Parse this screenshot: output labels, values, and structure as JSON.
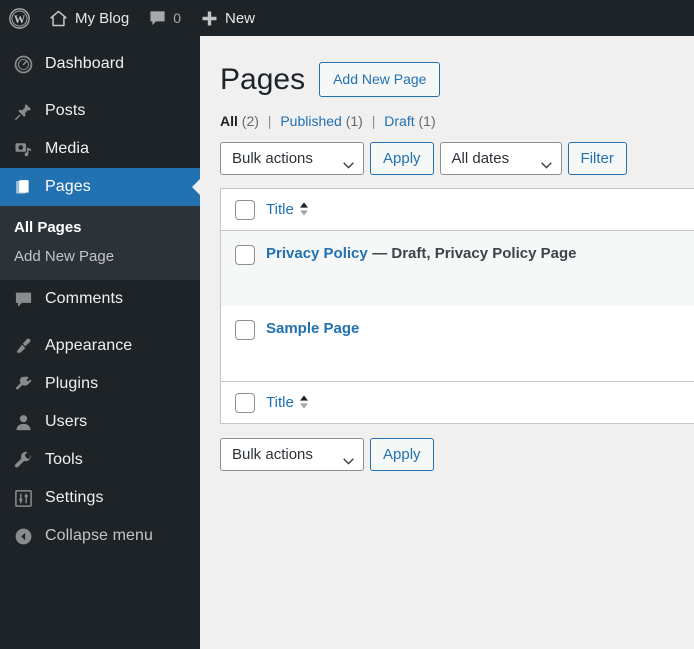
{
  "adminbar": {
    "wp_logo_icon": "wordpress-logo-icon",
    "site_home_icon": "home-icon",
    "site_name": "My Blog",
    "comments_icon": "comment-bubble-icon",
    "comments_count": "0",
    "new_icon": "plus-icon",
    "new_label": "New"
  },
  "sidebar": {
    "items": [
      {
        "label": "Dashboard",
        "icon": "dashboard-gauge-icon",
        "key": "dashboard"
      },
      {
        "label": "Posts",
        "icon": "pushpin-icon",
        "key": "posts"
      },
      {
        "label": "Media",
        "icon": "media-camera-music-icon",
        "key": "media"
      },
      {
        "label": "Pages",
        "icon": "pages-icon",
        "key": "pages"
      },
      {
        "label": "Comments",
        "icon": "comment-bubble-icon",
        "key": "comments"
      },
      {
        "label": "Appearance",
        "icon": "paintbrush-icon",
        "key": "appearance"
      },
      {
        "label": "Plugins",
        "icon": "plug-icon",
        "key": "plugins"
      },
      {
        "label": "Users",
        "icon": "user-icon",
        "key": "users"
      },
      {
        "label": "Tools",
        "icon": "wrench-icon",
        "key": "tools"
      },
      {
        "label": "Settings",
        "icon": "sliders-icon",
        "key": "settings"
      }
    ],
    "submenu": {
      "all_pages": "All Pages",
      "add_new_page": "Add New Page"
    },
    "collapse": {
      "label": "Collapse menu",
      "icon": "collapse-arrow-left-icon"
    },
    "current_item": "Pages",
    "current_subitem": "All Pages",
    "highlight_color": "#2271b1"
  },
  "main": {
    "title": "Pages",
    "add_new_button": "Add New Page",
    "filters": [
      {
        "label": "All",
        "count": "(2)",
        "current": true
      },
      {
        "label": "Published",
        "count": "(1)",
        "current": false
      },
      {
        "label": "Draft",
        "count": "(1)",
        "current": false
      }
    ],
    "filter_divider": "|",
    "toolbar_top": {
      "bulk_actions": "Bulk actions",
      "apply": "Apply",
      "all_dates": "All dates",
      "filter": "Filter"
    },
    "toolbar_bottom": {
      "bulk_actions": "Bulk actions",
      "apply": "Apply"
    },
    "table": {
      "column_title": "Title",
      "sort_icon": "sort-arrows-icon",
      "rows": [
        {
          "title": "Privacy Policy",
          "state": "— Draft, Privacy Policy Page",
          "alt": true
        },
        {
          "title": "Sample Page",
          "state": "",
          "alt": false
        }
      ]
    }
  },
  "colors": {
    "admin_blue": "#2271b1",
    "sidebar_bg": "#1d2327",
    "submenu_bg": "#2c3338",
    "page_bg": "#f0f0f1",
    "row_alt_bg": "#f6f7f7"
  }
}
